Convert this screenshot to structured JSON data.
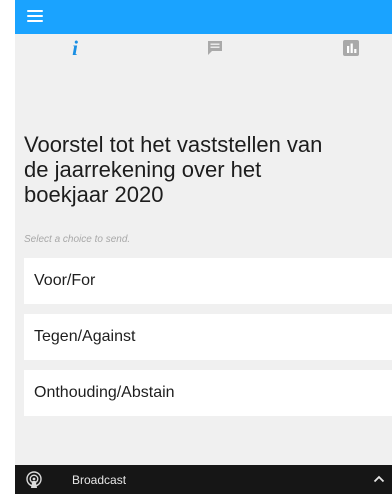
{
  "header": {
    "menu_icon": "hamburger-menu-icon",
    "accent_color": "#1aa3ff"
  },
  "tabs": [
    {
      "icon": "info-icon",
      "glyph": "i",
      "active": true
    },
    {
      "icon": "chat-icon",
      "active": false
    },
    {
      "icon": "results-chart-icon",
      "active": false
    }
  ],
  "poll": {
    "title": "Voorstel tot het vaststellen van de jaarrekening over het boekjaar 2020",
    "hint": "Select a choice to send.",
    "choices": [
      {
        "label": "Voor/For"
      },
      {
        "label": "Tegen/Against"
      },
      {
        "label": "Onthouding/Abstain"
      }
    ]
  },
  "footer": {
    "icon": "broadcast-icon",
    "label": "Broadcast",
    "toggle_icon": "chevron-up-icon"
  }
}
